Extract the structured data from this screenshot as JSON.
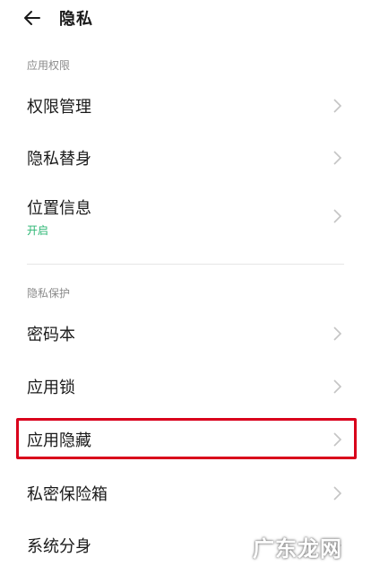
{
  "header": {
    "title": "隐私"
  },
  "sections": {
    "permissions": "应用权限",
    "protection": "隐私保护"
  },
  "rows": {
    "permission_management": "权限管理",
    "privacy_substitute": "隐私替身",
    "location": "位置信息",
    "location_status": "开启",
    "password_book": "密码本",
    "app_lock": "应用锁",
    "app_hide": "应用隐藏",
    "private_safe": "私密保险箱",
    "system_clone": "系统分身"
  },
  "watermark": "广东龙网",
  "colors": {
    "accent_green": "#2bb673",
    "highlight_red": "#d9001b",
    "section_gray": "#8a8a8a"
  }
}
